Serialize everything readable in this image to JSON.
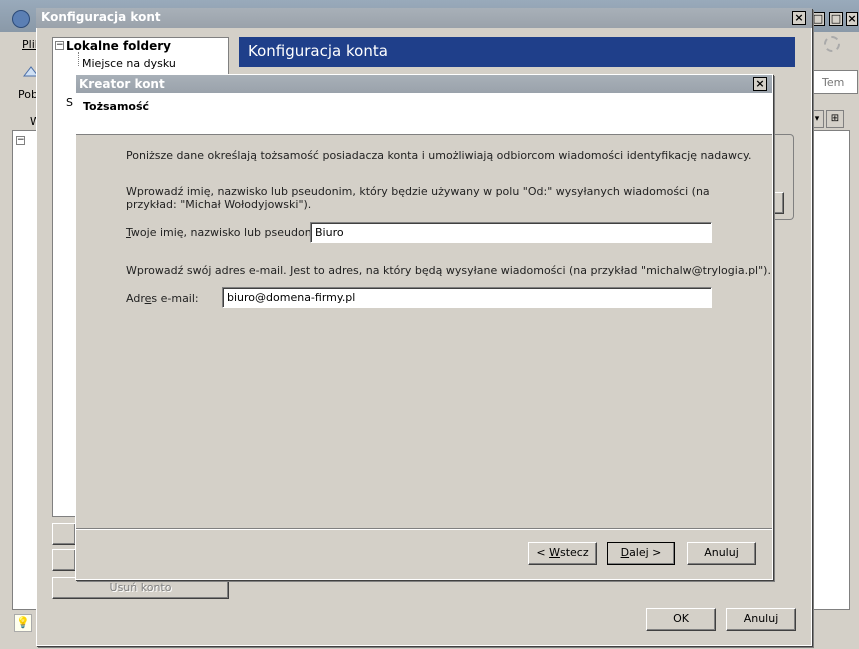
{
  "app": {
    "menu_label": "Plik",
    "toolbar_label": "Pob",
    "search_placeholder": "Tem",
    "pane_label_1": "W",
    "status_icon": "lightbulb-icon"
  },
  "config_window": {
    "title": "Konfiguracja kont",
    "tree": {
      "root": "Lokalne foldery",
      "child": "Miejsce na dysku"
    },
    "header_title": "Konfiguracja konta",
    "partial_label": "S",
    "remove_account": "Usuń konto",
    "ok": "OK",
    "cancel": "Anuluj"
  },
  "wizard": {
    "title": "Kreator kont",
    "page_title": "Tożsamość",
    "intro": "Poniższe dane określają tożsamość posiadacza konta i umożliwiają odbiorcom wiadomości identyfikację nadawcy.",
    "name_info": "Wprowadź imię, nazwisko lub pseudonim, który będzie używany w polu \"Od:\" wysyłanych wiadomości (na przykład: \"Michał Wołodyjowski\").",
    "name_label_ul": "T",
    "name_label_rest": "woje imię, nazwisko lub pseudonim:",
    "name_value": "Biuro",
    "email_info": "Wprowadź swój adres e-mail. Jest to adres, na który będą wysyłane wiadomości (na przykład \"michalw@trylogia.pl\").",
    "email_label_pre": "Adr",
    "email_label_ul": "e",
    "email_label_post": "s e-mail:",
    "email_value": "biuro@domena-firmy.pl",
    "back_pre": "< ",
    "back_ul": "W",
    "back_post": "stecz",
    "next_ul": "D",
    "next_post": "alej >",
    "cancel": "Anuluj"
  },
  "colors": {
    "header_band": "#1f3f8a",
    "titlebar": "#9aa2ab",
    "window_face": "#d4d0c8"
  }
}
